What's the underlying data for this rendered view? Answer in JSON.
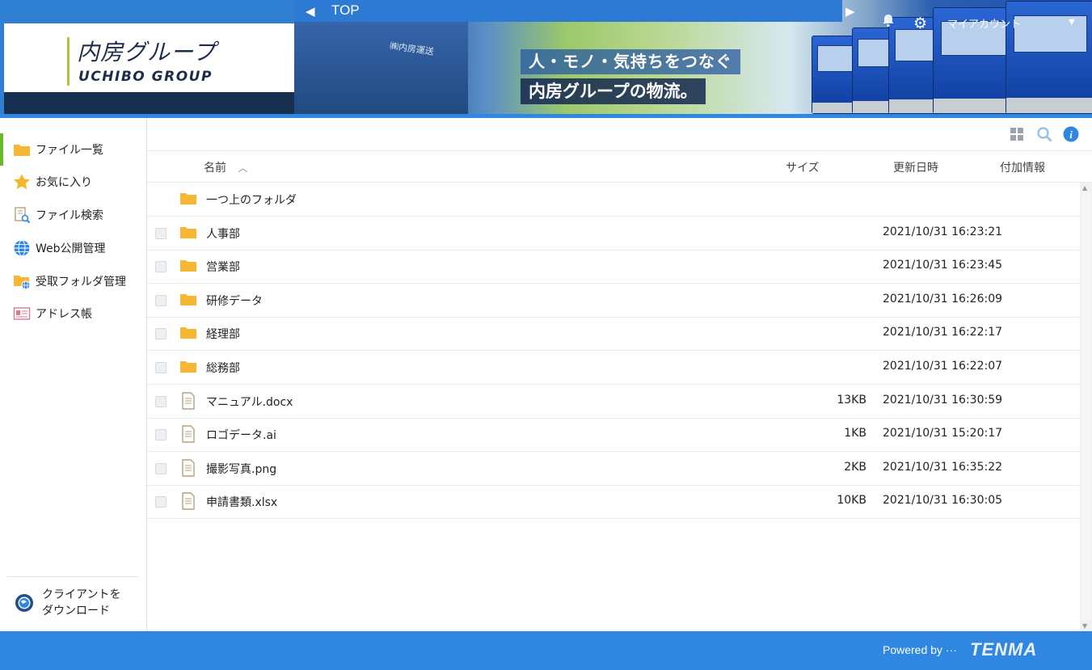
{
  "header": {
    "logo_jp": "内房グループ",
    "logo_en": "UCHIBO GROUP",
    "top_label": "TOP",
    "slogan_line1": "人・モノ・気持ちをつなぐ",
    "slogan_line2": "内房グループの物流。",
    "shirt_text": "㈱内房運送",
    "account_label": "マイアカウント"
  },
  "sidebar": {
    "items": [
      {
        "label": "ファイル一覧",
        "icon": "folder-icon"
      },
      {
        "label": "お気に入り",
        "icon": "star-icon"
      },
      {
        "label": "ファイル検索",
        "icon": "file-search-icon"
      },
      {
        "label": "Web公開管理",
        "icon": "globe-icon"
      },
      {
        "label": "受取フォルダ管理",
        "icon": "folder-globe-icon"
      },
      {
        "label": "アドレス帳",
        "icon": "address-card-icon"
      }
    ],
    "client_download": {
      "line1": "クライアントを",
      "line2": "ダウンロード"
    }
  },
  "table": {
    "columns": {
      "name": "名前",
      "size": "サイズ",
      "updated": "更新日時",
      "info": "付加情報"
    },
    "parent_folder": "一つ上のフォルダ",
    "rows": [
      {
        "name": "人事部",
        "type": "folder",
        "size": "",
        "updated": "2021/10/31 16:23:21"
      },
      {
        "name": "営業部",
        "type": "folder",
        "size": "",
        "updated": "2021/10/31 16:23:45"
      },
      {
        "name": "研修データ",
        "type": "folder",
        "size": "",
        "updated": "2021/10/31 16:26:09"
      },
      {
        "name": "経理部",
        "type": "folder",
        "size": "",
        "updated": "2021/10/31 16:22:17"
      },
      {
        "name": "総務部",
        "type": "folder",
        "size": "",
        "updated": "2021/10/31 16:22:07"
      },
      {
        "name": "マニュアル.docx",
        "type": "file",
        "size": "13KB",
        "updated": "2021/10/31 16:30:59"
      },
      {
        "name": "ロゴデータ.ai",
        "type": "file",
        "size": "1KB",
        "updated": "2021/10/31 15:20:17"
      },
      {
        "name": "撮影写真.png",
        "type": "file",
        "size": "2KB",
        "updated": "2021/10/31 16:35:22"
      },
      {
        "name": "申請書類.xlsx",
        "type": "file",
        "size": "10KB",
        "updated": "2021/10/31 16:30:05"
      }
    ]
  },
  "footer": {
    "powered": "Powered by ···",
    "brand": "TENMA"
  },
  "colors": {
    "accent": "#2f87e2",
    "active_nav": "#6ab82e",
    "folder": "#f7b733"
  }
}
